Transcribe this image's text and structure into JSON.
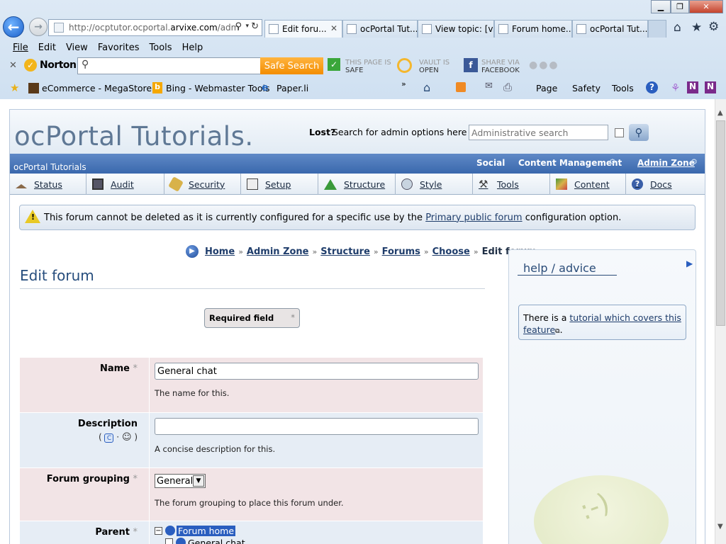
{
  "browser": {
    "address_prefix": "http://ocptutor.ocportal.",
    "address_domain": "arvixe.com",
    "address_suffix": "/adm",
    "tabs": [
      {
        "label": "Edit foru...",
        "active": true
      },
      {
        "label": "ocPortal Tut...",
        "active": false
      },
      {
        "label": "View topic: [v...",
        "active": false
      },
      {
        "label": "Forum home...",
        "active": false
      },
      {
        "label": "ocPortal Tut...",
        "active": false
      }
    ],
    "menu": [
      "File",
      "Edit",
      "View",
      "Favorites",
      "Tools",
      "Help"
    ],
    "norton": {
      "brand": "Norton",
      "safe_search_label": "Safe Search",
      "page_status_line1": "THIS PAGE IS",
      "page_status_line2": "SAFE",
      "vault_line1": "VAULT IS",
      "vault_line2": "OPEN",
      "share_line1": "SHARE VIA",
      "share_line2": "FACEBOOK"
    },
    "bookmarks": [
      "eCommerce - MegaStore ...",
      "Bing - Webmaster Tools",
      "Paper.li"
    ],
    "command_bar": [
      "Page",
      "Safety",
      "Tools"
    ]
  },
  "site": {
    "logo": "ocPortal Tutorials.",
    "lost_label": "Lost?",
    "search_prompt": "Search for admin options here →",
    "search_placeholder": "Administrative search",
    "breadcrumb_title": "ocPortal Tutorials",
    "zone_links": [
      "Social",
      "Content Management",
      "Admin Zone"
    ],
    "nav_tabs": [
      "Status",
      "Audit",
      "Security",
      "Setup",
      "Structure",
      "Style",
      "Tools",
      "Content",
      "Docs"
    ]
  },
  "warning": {
    "before": "This forum cannot be deleted as it is currently configured for a specific use by the ",
    "link": "Primary public forum",
    "after": " configuration option."
  },
  "breadcrumbs": [
    "Home",
    "Admin Zone",
    "Structure",
    "Forums",
    "Choose"
  ],
  "breadcrumb_current": "Edit forum",
  "page_title": "Edit forum",
  "required_field": "Required field",
  "form": {
    "name": {
      "label": "Name",
      "value": "General chat",
      "desc": "The name for this."
    },
    "description": {
      "label": "Description",
      "value": "",
      "desc": "A concise description for this."
    },
    "grouping": {
      "label": "Forum grouping",
      "value": "General",
      "desc": "The forum grouping to place this forum under."
    },
    "parent": {
      "label": "Parent",
      "tree_root": "Forum home",
      "tree_child": "General chat"
    }
  },
  "help": {
    "title": "help / advice",
    "before": "There is a ",
    "link": "tutorial which covers this feature",
    "after": "."
  }
}
